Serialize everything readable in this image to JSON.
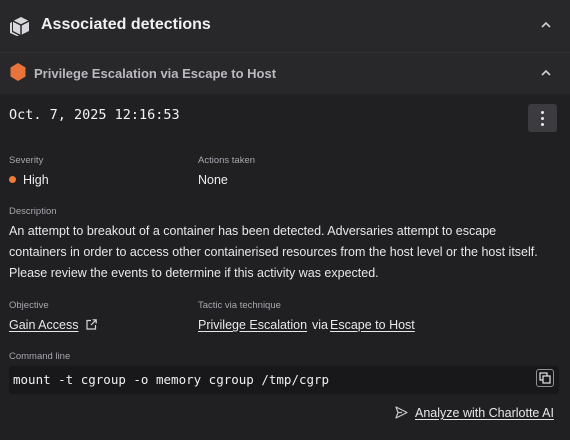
{
  "panel": {
    "title": "Associated detections",
    "icon": "stacked-cubes-icon",
    "chevron": "chevron-up-icon"
  },
  "detection": {
    "name": "Privilege Escalation via Escape to Host",
    "icon": "hexagon-icon",
    "icon_color": "#e8743b",
    "timestamp": "Oct. 7, 2025 12:16:53"
  },
  "fields": {
    "severity_label": "Severity",
    "severity_value": "High",
    "severity_color": "#f07a3a",
    "actions_label": "Actions taken",
    "actions_value": "None",
    "description_label": "Description",
    "description_line1": "An attempt to breakout of a container has been detected. Adversaries attempt to escape",
    "description_line2": "containers in order to access other containerised resources from the host level or the host itself.",
    "description_line3": "Please review the events to determine if this activity was expected.",
    "objective_label": "Objective",
    "objective_value": "Gain Access",
    "tactic_label": "Tactic via technique",
    "tactic_value": "Privilege Escalation",
    "via_text": "via",
    "technique_value": "Escape to Host",
    "command_label": "Command line",
    "command_value": "mount -t cgroup -o memory cgroup /tmp/cgrp"
  },
  "actions": {
    "analyze_label": "Analyze with Charlotte AI"
  }
}
